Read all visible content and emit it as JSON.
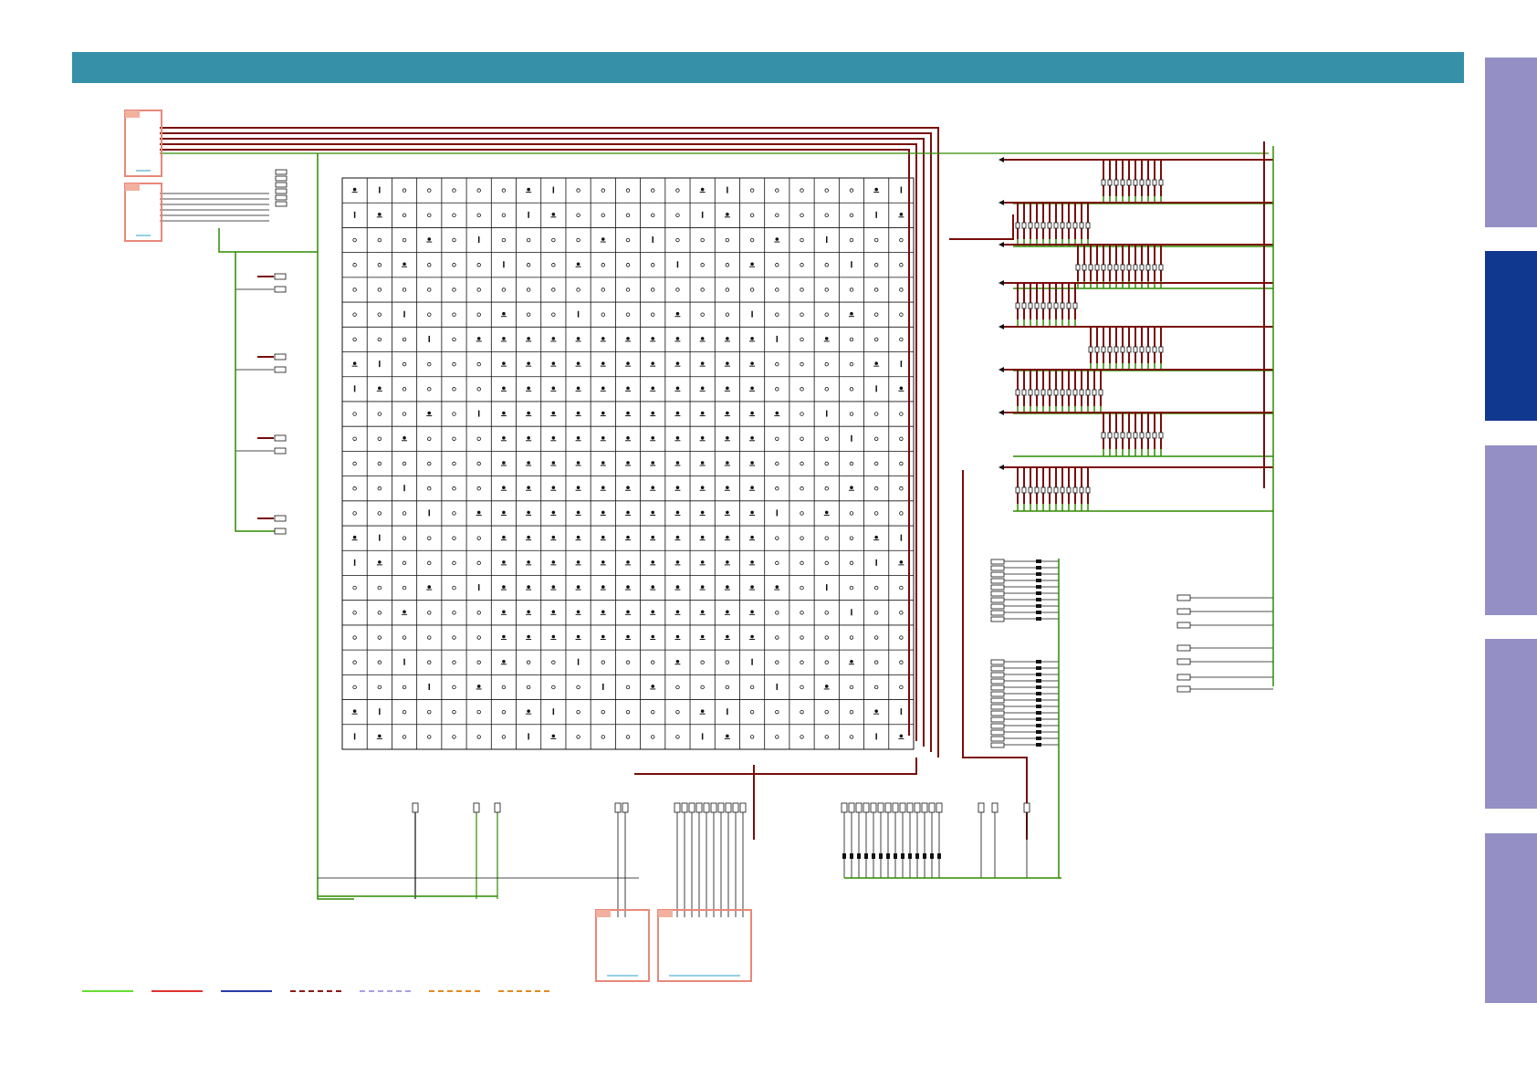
{
  "header": {
    "title": ""
  },
  "side_tabs": [
    {
      "label": "",
      "active": false
    },
    {
      "label": "",
      "active": true
    },
    {
      "label": "",
      "active": false
    },
    {
      "label": "",
      "active": false
    },
    {
      "label": "",
      "active": false
    }
  ],
  "colors": {
    "header": "#3690a8",
    "tab_inactive": "#9490c6",
    "tab_active": "#11388f",
    "ground_green": "#2e8b00",
    "signal_dark_red": "#7a0c0c",
    "wire_black": "#111111",
    "connector_box": "#e8887a",
    "connector_tab": "#f2b09f",
    "link_blue": "#2aa0c8"
  },
  "legend": [
    {
      "color": "#66dd33",
      "style": "solid"
    },
    {
      "color": "#e03030",
      "style": "solid"
    },
    {
      "color": "#2a3aa8",
      "style": "solid"
    },
    {
      "color": "#8a1a1a",
      "style": "dashed"
    },
    {
      "color": "#a7a0e0",
      "style": "dashed"
    },
    {
      "color": "#e08a20",
      "style": "dashed"
    },
    {
      "color": "#e08a20",
      "style": "dashed"
    }
  ],
  "bga": {
    "rows": 23,
    "cols": 23
  }
}
